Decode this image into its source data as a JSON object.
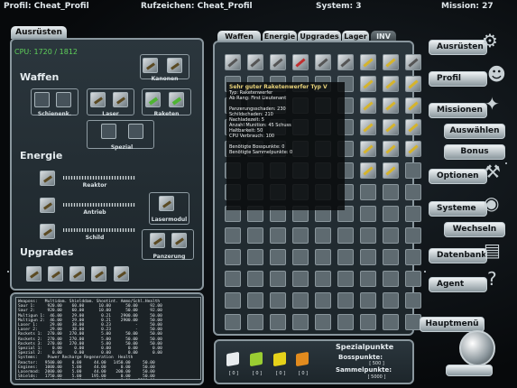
{
  "topbar": {
    "profile": "Profil: Cheat_Profil",
    "callsign": "Rufzeichen: Cheat_Profil",
    "system": "System: 3",
    "mission": "Mission: 27"
  },
  "left": {
    "tab": "Ausrüsten",
    "cpu": "CPU: 1720 / 1812",
    "waffen": "Waffen",
    "kanonen": "Kanonen",
    "schienenk": "Schienenk.",
    "laser": "Laser",
    "raketen": "Raketen",
    "spezial": "Spezial",
    "energie": "Energie",
    "reaktor": "Reaktor",
    "antrieb": "Antrieb",
    "lasermodul": "Lasermodul",
    "schild": "Schild",
    "upgrades": "Upgrades",
    "panzerung": "Panzerung"
  },
  "inv_tabs": [
    "Waffen",
    "Energie",
    "Upgrades",
    "Lager",
    "INV"
  ],
  "tooltip": {
    "title": "Sehr guter Raketenwerfer Typ V",
    "lines": [
      "Typ: Raketenwerfer",
      "Ab Rang: First Lieutenant",
      "",
      "Panzerungsschaden: 230",
      "Schildschaden: 210",
      "Nachladezeit: 5",
      "Anzahl Munition: 45 Schuss",
      "Haltbarkeit: 50",
      "CPU Verbrauch: 100",
      "",
      "Benötigte Bosspunkte: 0",
      "Benötigte Sammelpunkte: 0"
    ]
  },
  "right_menu": {
    "ausruesten": "Ausrüsten",
    "profil": "Profil",
    "missionen": "Missionen",
    "auswaehlen": "Auswählen",
    "bonus": "Bonus",
    "optionen": "Optionen",
    "systeme": "Systeme",
    "wechseln": "Wechseln",
    "datenbank": "Datenbank",
    "agent": "Agent",
    "hauptmenue": "Hauptmenü"
  },
  "stats_table": "Weapons:   Multidam. Shielddam. Shootint. Ammo/Schl.Health\nSaur 1:     920.00    60.00      10.00      50.00     92.00\nSaur 2:     920.00    60.00      10.00      50.00     92.00\nMultigun 1:  46.00    29.00       0.21    2900.00     50.00\nMultigun 2:  46.00    29.00       0.21    2900.00     50.00\nLaser 1:     29.00    38.00       0.23          -     50.00\nLaser 2:     29.00    38.00       0.23          -     50.00\nRockets 1:  270.00   270.00       5.00      50.00     50.00\nRockets 2:  270.00   270.00       5.00      50.00     50.00\nRockets 3:  270.00   270.00       5.00      50.00     50.00\nSpezial 1:    0.00     0.00       0.00       0.00      0.00\nSpezial 2:    0.00     0.00       0.00       0.00      0.00\nSystems:    Power Recharge Regeneration  Health\nReactor:   9500.00    0.00     44.00   1450.00     50.00\nEngines:   1000.00    5.00     44.00      0.00     50.00\nLasermod:  2000.00    5.00     44.00    200.00     50.00\nShields:   1750.00    5.00    195.00      0.00     50.00\nArmor 1:      0.00    0.00      0.00      0.00   5500.00\nArmor 2:      0.00    0.00      0.00      0.00   5500.00",
  "bottom": {
    "cube_vals": [
      "[ 0 ]",
      "[ 0 ]",
      "[ 0 ]",
      "[ 0 ]"
    ],
    "spezialpunkte": "Spezialpunkte",
    "bosspunkte": "Bosspunkte:",
    "boss_val": "[ 500 ]",
    "sammelpunkte": "Sammelpunkte:",
    "sammel_val": "[ 5000 ]",
    "cube_colors": [
      "#e8ecee",
      "#9acd32",
      "#e6d21a",
      "#e28b1e"
    ]
  }
}
